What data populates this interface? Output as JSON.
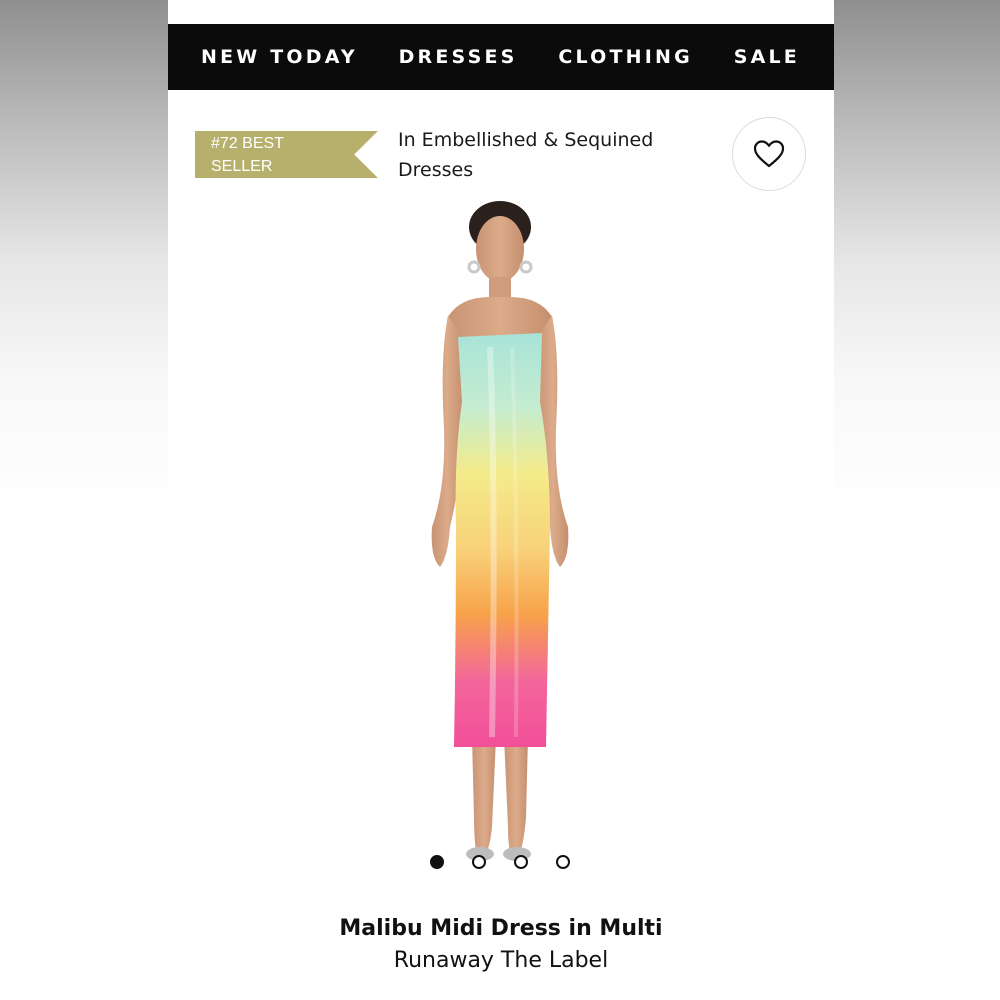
{
  "nav": {
    "items": [
      {
        "label": "NEW TODAY"
      },
      {
        "label": "DRESSES"
      },
      {
        "label": "CLOTHING"
      },
      {
        "label": "SALE"
      }
    ]
  },
  "badge": {
    "line1": "#72 BEST",
    "line2": "SELLER",
    "color": "#b6b06c"
  },
  "category": {
    "line1": "In Embellished & Sequined",
    "line2": "Dresses"
  },
  "favorite": {
    "icon": "heart-icon"
  },
  "gallery": {
    "image_count": 4,
    "active_index": 0
  },
  "product": {
    "name": "Malibu Midi Dress in Multi",
    "brand": "Runaway The Label"
  },
  "colors": {
    "nav_bg": "#0b0b0b",
    "dress_top": "#a8e3d8",
    "dress_mid": "#f7e07a",
    "dress_orange": "#f7a24a",
    "dress_bottom": "#f24f9a"
  }
}
